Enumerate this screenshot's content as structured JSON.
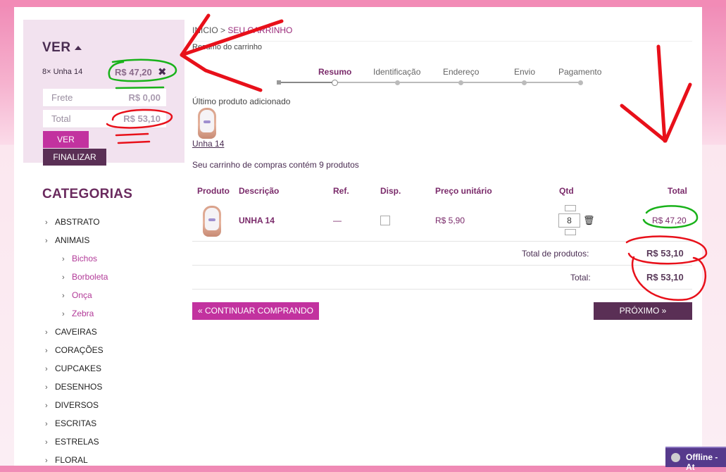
{
  "cart_summary": {
    "title": "VER",
    "item_text": "8× Unha 14",
    "item_price": "R$ 47,20",
    "remove_icon": "close-x-icon",
    "frete_label": "Frete",
    "frete_value": "R$ 0,00",
    "total_label": "Total",
    "total_value": "R$ 53,10",
    "ver_button": "VER",
    "finalizar_button": "FINALIZAR"
  },
  "categories": {
    "title": "CATEGORIAS",
    "items": [
      "ABSTRATO",
      "ANIMAIS",
      "Bichos",
      "Borboleta",
      "Onça",
      "Zebra",
      "CAVEIRAS",
      "CORAÇÕES",
      "CUPCAKES",
      "DESENHOS",
      "DIVERSOS",
      "ESCRITAS",
      "ESTRELAS",
      "FLORAL"
    ]
  },
  "breadcrumb": {
    "home": "INÍCIO",
    "separator": ">",
    "current": "SEU CARRINHO"
  },
  "summary_heading": "Resumo do carrinho",
  "steps": [
    "Resumo",
    "Identificação",
    "Endereço",
    "Envio",
    "Pagamento"
  ],
  "last_added": {
    "label": "Último produto adicionado",
    "product_link": "Unha 14"
  },
  "cart_count_text": "Seu carrinho de compras contém 9 produtos",
  "table": {
    "headers": [
      "Produto",
      "Descrição",
      "Ref.",
      "Disp.",
      "Preço unitário",
      "Qtd",
      "Total"
    ],
    "row": {
      "description": "UNHA 14",
      "ref": "—",
      "unit_price": "R$ 5,90",
      "qty": "8",
      "total": "R$ 47,20"
    }
  },
  "totals": {
    "products_label": "Total de produtos:",
    "products_value": "R$ 53,10",
    "total_label": "Total:",
    "total_value": "R$ 53,10"
  },
  "buttons": {
    "continue": "« CONTINUAR COMPRANDO",
    "next": "PRÓXIMO »"
  },
  "chat": {
    "status": "Offline - At"
  },
  "colors": {
    "accent_pink": "#c2329f",
    "dark_purple": "#5a2f55",
    "annotation_red": "#e8101a",
    "annotation_green": "#19b21a"
  }
}
